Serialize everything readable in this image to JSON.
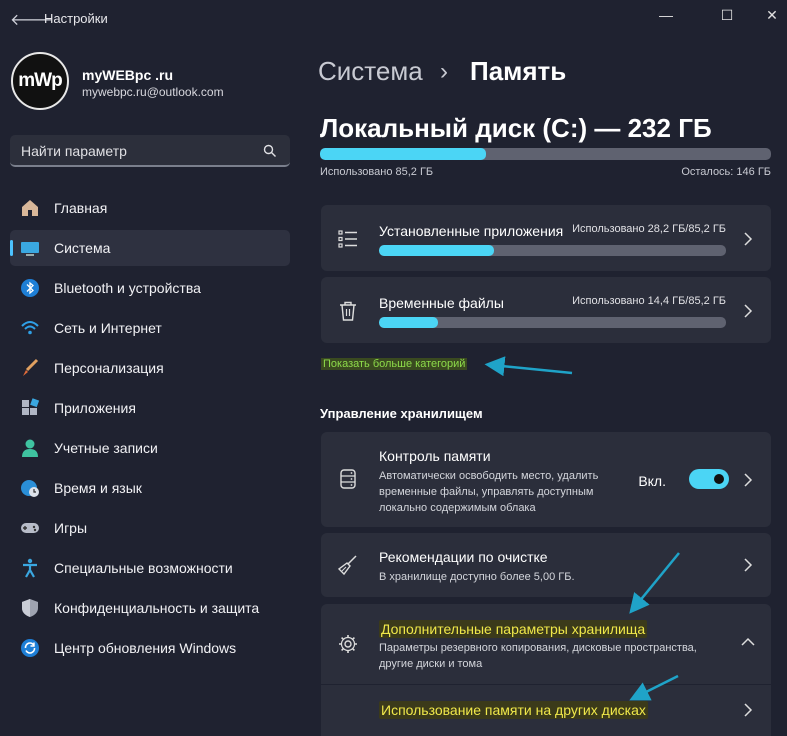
{
  "window": {
    "title": "Настройки"
  },
  "profile": {
    "avatar_text": "mWp",
    "name": "myWEBpc .ru",
    "email": "mywebpc.ru@outlook.com"
  },
  "search": {
    "placeholder": "Найти параметр"
  },
  "nav": {
    "items": [
      {
        "label": "Главная",
        "icon": "home-icon"
      },
      {
        "label": "Система",
        "icon": "system-icon",
        "active": true
      },
      {
        "label": "Bluetooth и устройства",
        "icon": "bluetooth-icon"
      },
      {
        "label": "Сеть и Интернет",
        "icon": "wifi-icon"
      },
      {
        "label": "Персонализация",
        "icon": "brush-icon"
      },
      {
        "label": "Приложения",
        "icon": "apps-icon"
      },
      {
        "label": "Учетные записи",
        "icon": "account-icon"
      },
      {
        "label": "Время и язык",
        "icon": "globe-clock-icon"
      },
      {
        "label": "Игры",
        "icon": "gamepad-icon"
      },
      {
        "label": "Специальные возможности",
        "icon": "accessibility-icon"
      },
      {
        "label": "Конфиденциальность и защита",
        "icon": "shield-icon"
      },
      {
        "label": "Центр обновления Windows",
        "icon": "update-icon"
      }
    ]
  },
  "breadcrumb": {
    "parent": "Система",
    "separator": "›",
    "current": "Память"
  },
  "disk": {
    "title": "Локальный диск (C:) — 232 ГБ",
    "used_label": "Использовано 85,2 ГБ",
    "free_label": "Осталось: 146 ГБ",
    "used_fraction": 0.367
  },
  "categories": [
    {
      "title": "Установленные приложения",
      "usage": "Использовано 28,2 ГБ/85,2 ГБ",
      "fraction": 0.331,
      "icon": "list-icon"
    },
    {
      "title": "Временные файлы",
      "usage": "Использовано 14,4 ГБ/85,2 ГБ",
      "fraction": 0.169,
      "icon": "trash-icon"
    }
  ],
  "show_more": "Показать больше категорий",
  "storage_management": {
    "title": "Управление хранилищем",
    "storage_sense": {
      "title": "Контроль памяти",
      "desc_line1": "Автоматически освободить место, удалить",
      "desc_line2": "временные файлы, управлять доступным",
      "desc_line3": "локально содержимым облака",
      "toggle_label": "Вкл.",
      "toggle_on": true
    },
    "cleanup": {
      "title": "Рекомендации по очистке",
      "desc": "В хранилище доступно более 5,00 ГБ."
    },
    "advanced": {
      "title": "Дополнительные параметры хранилища",
      "desc_line1": "Параметры резервного копирования, дисковые пространства,",
      "desc_line2": "другие диски и тома",
      "expanded": true
    },
    "other_disks": {
      "title": "Использование памяти на других дисках"
    }
  },
  "colors": {
    "accent": "#4bd5f5",
    "background": "#1f2230",
    "card": "#2b2e3b",
    "annotation_arrow": "#1fa3c8",
    "highlight": "#f0e84a"
  }
}
